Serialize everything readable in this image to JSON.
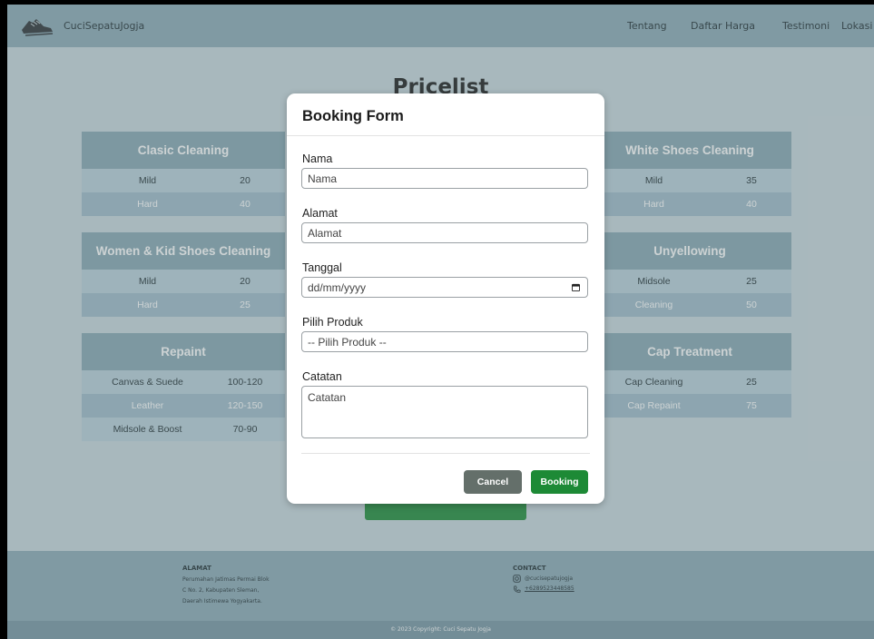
{
  "nav": {
    "brand": "CuciSepatuJogja",
    "logo_icon": "sneakers-logo-icon",
    "links": [
      "Tentang",
      "Daftar Harga",
      "Testimoni",
      "Lokasi"
    ]
  },
  "page": {
    "title": "Pricelist"
  },
  "pricelist": {
    "left": [
      {
        "title": "Clasic Cleaning",
        "rows": [
          {
            "name": "Mild",
            "price": "20"
          },
          {
            "name": "Hard",
            "price": "40"
          }
        ]
      },
      {
        "title": "Women & Kid Shoes Cleaning",
        "rows": [
          {
            "name": "Mild",
            "price": "20"
          },
          {
            "name": "Hard",
            "price": "25"
          }
        ]
      },
      {
        "title": "Repaint",
        "rows": [
          {
            "name": "Canvas & Suede",
            "price": "100-120"
          },
          {
            "name": "Leather",
            "price": "120-150"
          },
          {
            "name": "Midsole & Boost",
            "price": "70-90"
          }
        ]
      }
    ],
    "right": [
      {
        "title": "White Shoes Cleaning",
        "rows": [
          {
            "name": "Mild",
            "price": "35"
          },
          {
            "name": "Hard",
            "price": "40"
          }
        ]
      },
      {
        "title": "Unyellowing",
        "rows": [
          {
            "name": "Midsole",
            "price": "25"
          },
          {
            "name": "Cleaning",
            "price": "50"
          }
        ]
      },
      {
        "title": "Cap Treatment",
        "rows": [
          {
            "name": "Cap Cleaning",
            "price": "25"
          },
          {
            "name": "Cap Repaint",
            "price": "75"
          }
        ]
      }
    ]
  },
  "modal": {
    "title": "Booking Form",
    "fields": {
      "nama": {
        "label": "Nama",
        "placeholder": "Nama"
      },
      "alamat": {
        "label": "Alamat",
        "placeholder": "Alamat"
      },
      "tanggal": {
        "label": "Tanggal",
        "placeholder": "dd/mm/yyyy"
      },
      "produk": {
        "label": "Pilih Produk",
        "selected": "-- Pilih Produk --"
      },
      "catatan": {
        "label": "Catatan",
        "placeholder": "Catatan"
      }
    },
    "cancel_label": "Cancel",
    "booking_label": "Booking"
  },
  "footer": {
    "alamat_title": "ALAMAT",
    "alamat_lines": [
      "Perumahan Jatimas Permai Blok",
      "C No. 2, Kabupaten Sleman,",
      "Daerah Istimewa Yogyakarta."
    ],
    "contact_title": "CONTACT",
    "instagram": "@cucisepatujogja",
    "phone": "+6289523448585",
    "copyright": "© 2023 Copyright: Cuci Sepatu Jogja"
  },
  "colors": {
    "accent_green": "#1d8a36",
    "header_blue": "#8aa9b6",
    "card_header": "#86a6b3"
  }
}
